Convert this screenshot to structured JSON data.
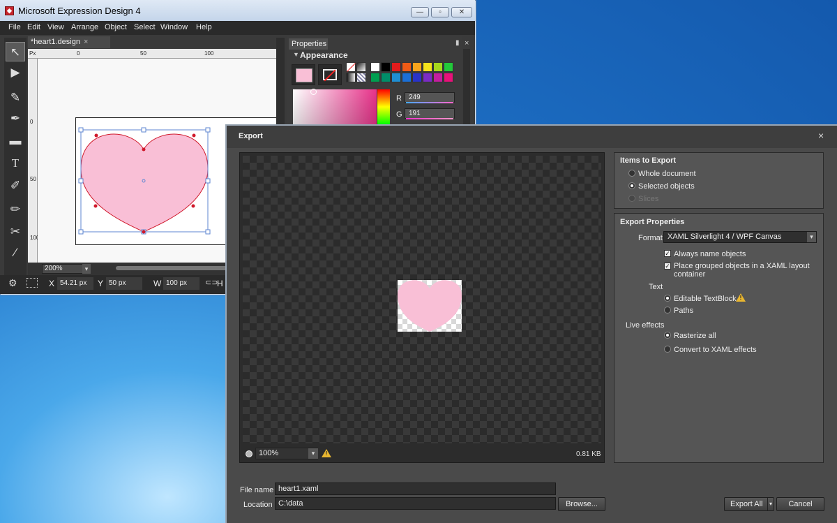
{
  "app": {
    "title": "Microsoft Expression Design 4",
    "menu": [
      "File",
      "Edit",
      "View",
      "Arrange",
      "Object",
      "Select",
      "Window",
      "Help"
    ],
    "doc_tab": "*heart1.design",
    "ruler_units": "Px",
    "ruler_top_ticks": [
      "0",
      "50",
      "100"
    ],
    "ruler_left_ticks": [
      "0",
      "50",
      "100"
    ],
    "zoom": "200%",
    "coords": {
      "x_label": "X",
      "x_value": "54.21 px",
      "y_label": "Y",
      "y_value": "50 px",
      "w_label": "W",
      "w_value": "100 px",
      "h_label": "H"
    },
    "properties_tab": "Properties",
    "appearance_label": "Appearance",
    "r_label": "R",
    "r_value": "249",
    "g_label": "G",
    "g_value": "191",
    "heart_color": "#f9bfd6",
    "swatch_colors": [
      "#ffffff",
      "#000000",
      "#e11c1c",
      "#ef5b16",
      "#f7a41c",
      "#f5e31c",
      "#a6d81c",
      "#22c93a",
      "#009e50",
      "#008d69",
      "#1f8ed2",
      "#1b6fd6",
      "#2a33c8",
      "#7b2cc4",
      "#c41e9e",
      "#e8117a"
    ]
  },
  "export": {
    "title": "Export",
    "close": "×",
    "preview_zoom": "100%",
    "file_size": "0.81 KB",
    "items_title": "Items to Export",
    "items": [
      {
        "label": "Whole document",
        "selected": false,
        "enabled": true
      },
      {
        "label": "Selected objects",
        "selected": true,
        "enabled": true
      },
      {
        "label": "Slices",
        "selected": false,
        "enabled": false
      }
    ],
    "props_title": "Export Properties",
    "format_label": "Format",
    "format_value": "XAML Silverlight 4 / WPF Canvas",
    "always_name": "Always name objects",
    "place_grouped_1": "Place grouped objects in a XAML layout",
    "place_grouped_2": "container",
    "text_label": "Text",
    "text_options": [
      {
        "label": "Editable TextBlock",
        "selected": true
      },
      {
        "label": "Paths",
        "selected": false
      }
    ],
    "live_label": "Live effects",
    "live_options": [
      {
        "label": "Rasterize all",
        "selected": true
      },
      {
        "label": "Convert to XAML effects",
        "selected": false
      }
    ],
    "file_name_label": "File name",
    "file_name": "heart1.xaml",
    "location_label": "Location",
    "location": "C:\\data",
    "browse": "Browse...",
    "export_all": "Export All",
    "cancel": "Cancel"
  }
}
